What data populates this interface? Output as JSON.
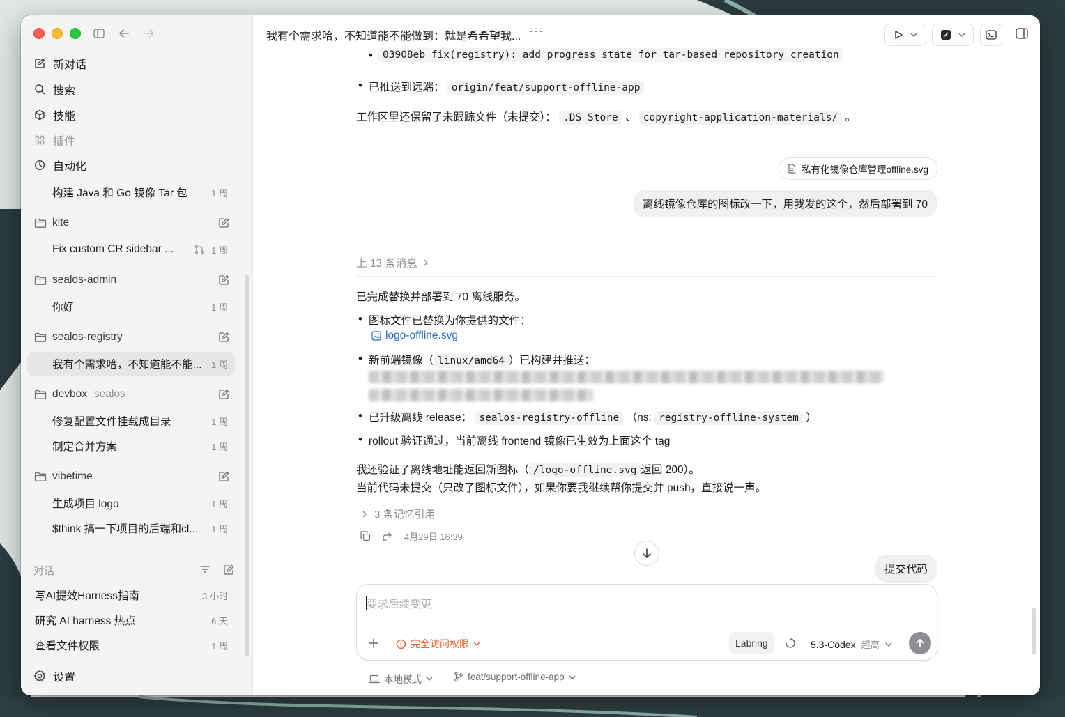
{
  "sidebar": {
    "nav": {
      "new_chat": "新对话",
      "search": "搜索",
      "skills": "技能",
      "plugins": "插件",
      "automation": "自动化"
    },
    "automation_items": [
      {
        "title": "构建 Java 和 Go 镜像 Tar 包",
        "time": "1 周"
      }
    ],
    "projects": [
      {
        "name": "kite",
        "sub": "",
        "threads": [
          {
            "title": "Fix custom CR sidebar ...",
            "time": "1 周",
            "has_pr": true
          }
        ]
      },
      {
        "name": "sealos-admin",
        "sub": "",
        "threads": [
          {
            "title": "你好",
            "time": "1 周"
          }
        ]
      },
      {
        "name": "sealos-registry",
        "sub": "",
        "threads": [
          {
            "title": "我有个需求哈，不知道能不能...",
            "time": "1 周",
            "active": true
          }
        ]
      },
      {
        "name": "devbox",
        "sub": "sealos",
        "threads": [
          {
            "title": "修复配置文件挂载成目录",
            "time": "1 周"
          },
          {
            "title": "制定合并方案",
            "time": "1 周"
          }
        ]
      },
      {
        "name": "vibetime",
        "sub": "",
        "threads": [
          {
            "title": "生成项目 logo",
            "time": "1 周"
          },
          {
            "title": "$think 搞一下项目的后端和cl...",
            "time": "1 周"
          }
        ]
      }
    ],
    "chats_label": "对话",
    "chats": [
      {
        "title": "写AI提效Harness指南",
        "time": "3 小时"
      },
      {
        "title": "研究 AI harness 热点",
        "time": "6 天"
      },
      {
        "title": "查看文件权限",
        "time": "1 周"
      }
    ],
    "settings": "设置"
  },
  "header": {
    "title": "我有个需求哈，不知道能不能做到：就是希希望我...",
    "more": "···"
  },
  "messages": {
    "commit_line": "03908eb fix(registry): add progress state for tar-based repository creation",
    "pushed_label": "已推送到远端：",
    "pushed_branch": "origin/feat/support-offline-app",
    "untracked_prefix": "工作区里还保留了未跟踪文件（未提交）：",
    "untracked_file1": ".DS_Store",
    "untracked_sep": "、",
    "untracked_file2": "copyright-application-materials/",
    "untracked_end": "。",
    "attachment_name": "私有化镜像仓库管理offline.svg",
    "user_message": "离线镜像仓库的图标改一下，用我发的这个，然后部署到 70",
    "prev_messages": "上 13 条消息",
    "done_line": "已完成替换并部署到 70 离线服务。",
    "b1": "图标文件已替换为你提供的文件：",
    "b1_file": "logo-offline.svg",
    "b2_pre": "新前端镜像（",
    "b2_code": "linux/amd64",
    "b2_post": "）已构建并推送：",
    "b3_pre": "已升级离线 release：",
    "b3_code1": "sealos-registry-offline",
    "b3_mid": "（ns:",
    "b3_code2": "registry-offline-system",
    "b3_end": "）",
    "b4": "rollout 验证通过，当前离线 frontend 镜像已生效为上面这个 tag",
    "verify_pre": "我还验证了离线地址能返回新图标（",
    "verify_code": "/logo-offline.svg",
    "verify_post": "返回 200）。",
    "uncommitted": "当前代码未提交（只改了图标文件），如果你要我继续帮你提交并 push，直接说一声。",
    "memory_refs": "3 条记忆引用",
    "timestamp": "4月29日 16:39",
    "user_message2": "提交代码"
  },
  "composer": {
    "placeholder": "要求后续变更",
    "permission": "完全访问权限",
    "chip": "Labring",
    "model": "5.3-Codex",
    "level": "超高"
  },
  "footer": {
    "mode": "本地模式",
    "branch": "feat/support-offline-app"
  },
  "colors": {
    "accent_link": "#2a6bd1",
    "permission": "#e8622a",
    "active_row": "#e6e6e9"
  }
}
